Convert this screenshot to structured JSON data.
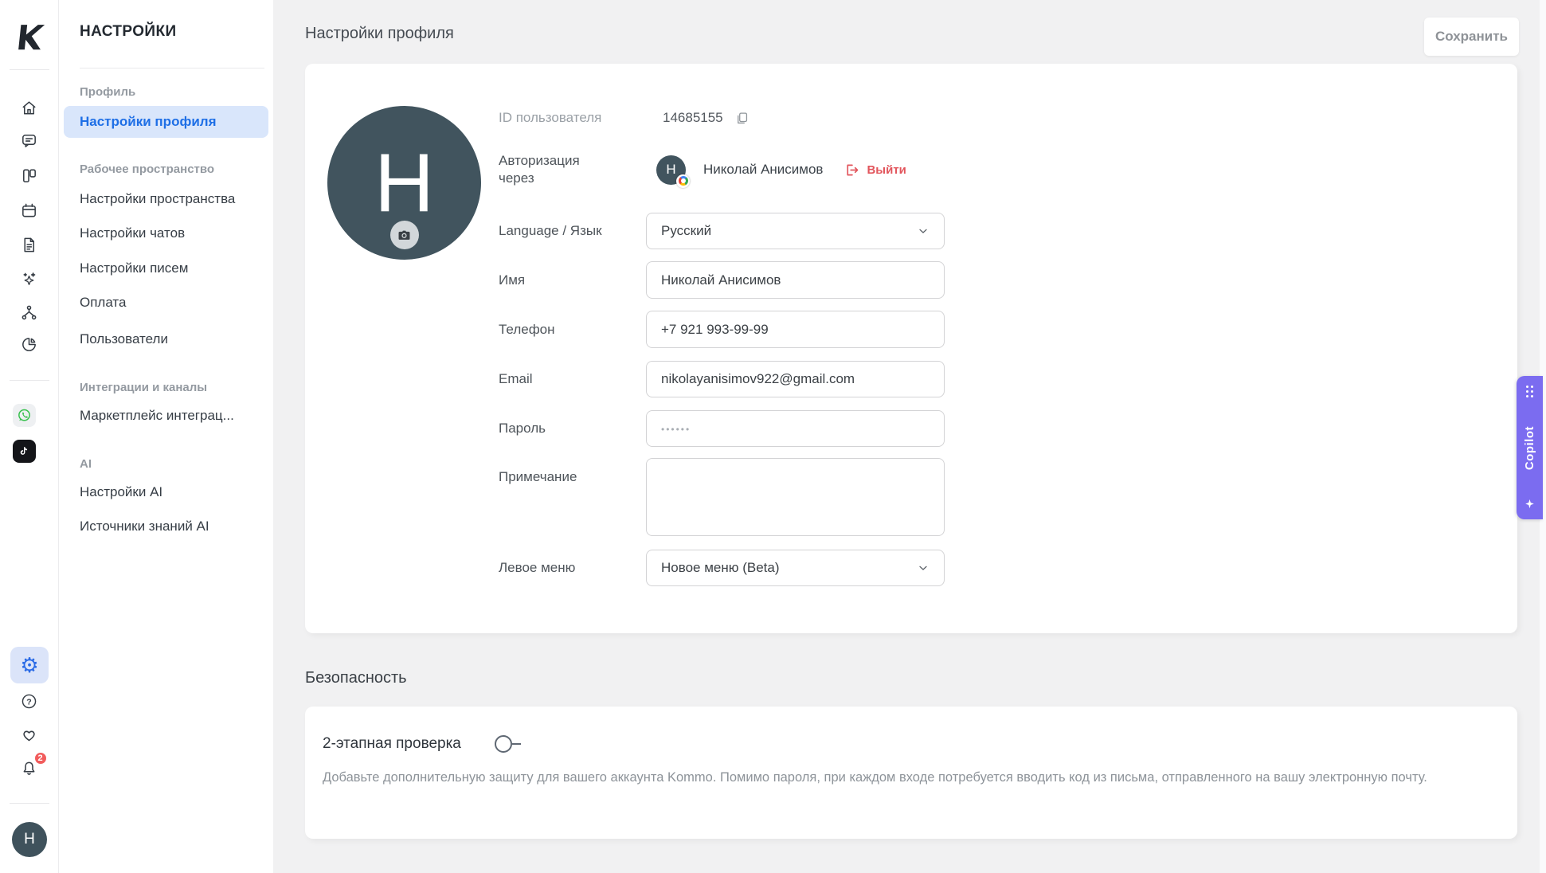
{
  "rail": {
    "avatar_letter": "H",
    "icon_names": [
      "kommo-logo",
      "home",
      "chats",
      "pipeline",
      "calendar",
      "documents",
      "ai-sparkles",
      "automation",
      "stats-pie",
      "whatsapp",
      "tiktok",
      "settings-gear",
      "help",
      "favorites",
      "notifications",
      "profile-avatar"
    ]
  },
  "icons": {
    "kommo-logo": "K",
    "home": "⌂",
    "chats": "💬",
    "pipeline": "▯▯",
    "calendar": "▦",
    "documents": "▤",
    "ai-sparkles": "✦",
    "automation": "⑂",
    "stats-pie": "◔",
    "whatsapp": "✆",
    "tiktok": "♪",
    "settings-gear": "⚙",
    "help": "?",
    "favorites": "♡",
    "notifications": "🔔",
    "camera": "📷",
    "copy": "⧉",
    "logout": "⎋",
    "chevron-down": "⌄",
    "drag-dots": "⠿",
    "copilot-sparkle": "✦",
    "google": "G"
  },
  "notifications": {
    "badge_count": "2"
  },
  "sidebar": {
    "title": "НАСТРОЙКИ",
    "sections": [
      {
        "label": "Профиль",
        "items": [
          {
            "label": "Настройки профиля",
            "active": true
          }
        ]
      },
      {
        "label": "Рабочее пространство",
        "items": [
          {
            "label": "Настройки пространства"
          },
          {
            "label": "Настройки чатов"
          },
          {
            "label": "Настройки писем"
          },
          {
            "label": "Оплата"
          },
          {
            "label": "Пользователи"
          }
        ]
      },
      {
        "label": "Интеграции и каналы",
        "items": [
          {
            "label": "Маркетплейс интеграц..."
          }
        ]
      },
      {
        "label": "AI",
        "items": [
          {
            "label": "Настройки AI"
          },
          {
            "label": "Источники знаний AI"
          }
        ]
      }
    ]
  },
  "header": {
    "title": "Настройки профиля",
    "save_button": "Сохранить"
  },
  "profile": {
    "avatar_letter": "H",
    "id_label": "ID пользователя",
    "id_value": "14685155",
    "auth_label": "Авторизация через",
    "auth_avatar_letter": "H",
    "auth_name": "Николай Анисимов",
    "logout": "Выйти",
    "fields": {
      "language": {
        "label": "Language / Язык",
        "value": "Русский"
      },
      "name": {
        "label": "Имя",
        "value": "Николай Анисимов"
      },
      "phone": {
        "label": "Телефон",
        "value": "+7 921 993-99-99"
      },
      "email": {
        "label": "Email",
        "value": "nikolayanisimov922@gmail.com"
      },
      "password": {
        "label": "Пароль",
        "placeholder": "••••••"
      },
      "note": {
        "label": "Примечание",
        "value": ""
      },
      "left_menu": {
        "label": "Левое меню",
        "value": "Новое меню (Beta)"
      }
    }
  },
  "security": {
    "heading": "Безопасность",
    "two_step_title": "2-этапная проверка",
    "two_step_enabled": false,
    "description": "Добавьте дополнительную защиту для вашего аккаунта Kommo. Помимо пароля, при каждом входе потребуется вводить код из письма, отправленного на вашу электронную почту."
  },
  "copilot": {
    "label": "Copilot"
  },
  "colors": {
    "accent_blue": "#1e6fe6",
    "active_item_bg": "#d9e6fb",
    "logout_red": "#e2555c",
    "badge_red": "#f25c5c",
    "copilot_purple": "#7b6cf0",
    "avatar_bg": "#41545e",
    "page_bg": "#f1f1f2",
    "card_bg": "#ffffff",
    "whatsapp_green": "#35c04b"
  }
}
